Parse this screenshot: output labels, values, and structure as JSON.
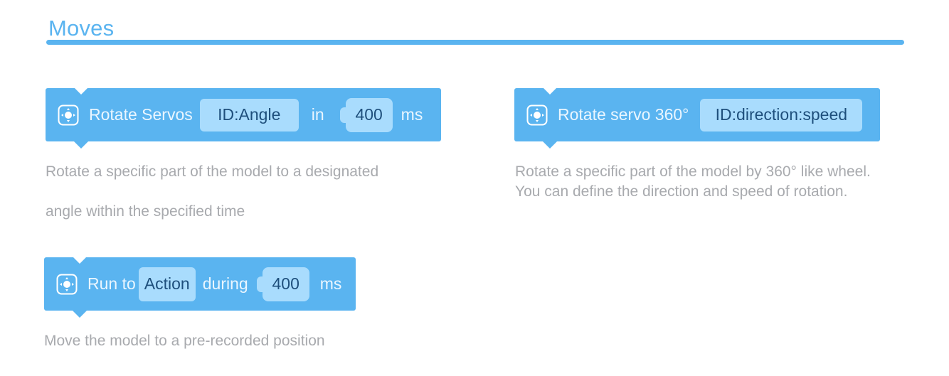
{
  "section": {
    "title": "Moves"
  },
  "blocks": [
    {
      "icon": "servo-icon",
      "label": "Rotate Servos",
      "param_chip": "ID:Angle",
      "in_label": "in",
      "time_value": "400",
      "unit": "ms",
      "description": [
        "Rotate a specific part of the model to a designated",
        "angle within the specified time"
      ]
    },
    {
      "icon": "servo-icon",
      "label": "Rotate servo 360°",
      "param_chip": "ID:direction:speed",
      "description": [
        "Rotate a specific part of the model by 360° like wheel.",
        "You can define the direction and speed of rotation."
      ]
    },
    {
      "icon": "servo-icon",
      "label": "Run to",
      "param_chip": "Action",
      "during_label": "during",
      "time_value": "400",
      "unit": "ms",
      "description": [
        "Move the model to a pre-recorded position"
      ]
    }
  ],
  "colors": {
    "accent": "#5ab4f0",
    "chip": "#a9dcfd",
    "chip_text": "#1e4f7c",
    "description_text": "#a8aaae"
  }
}
